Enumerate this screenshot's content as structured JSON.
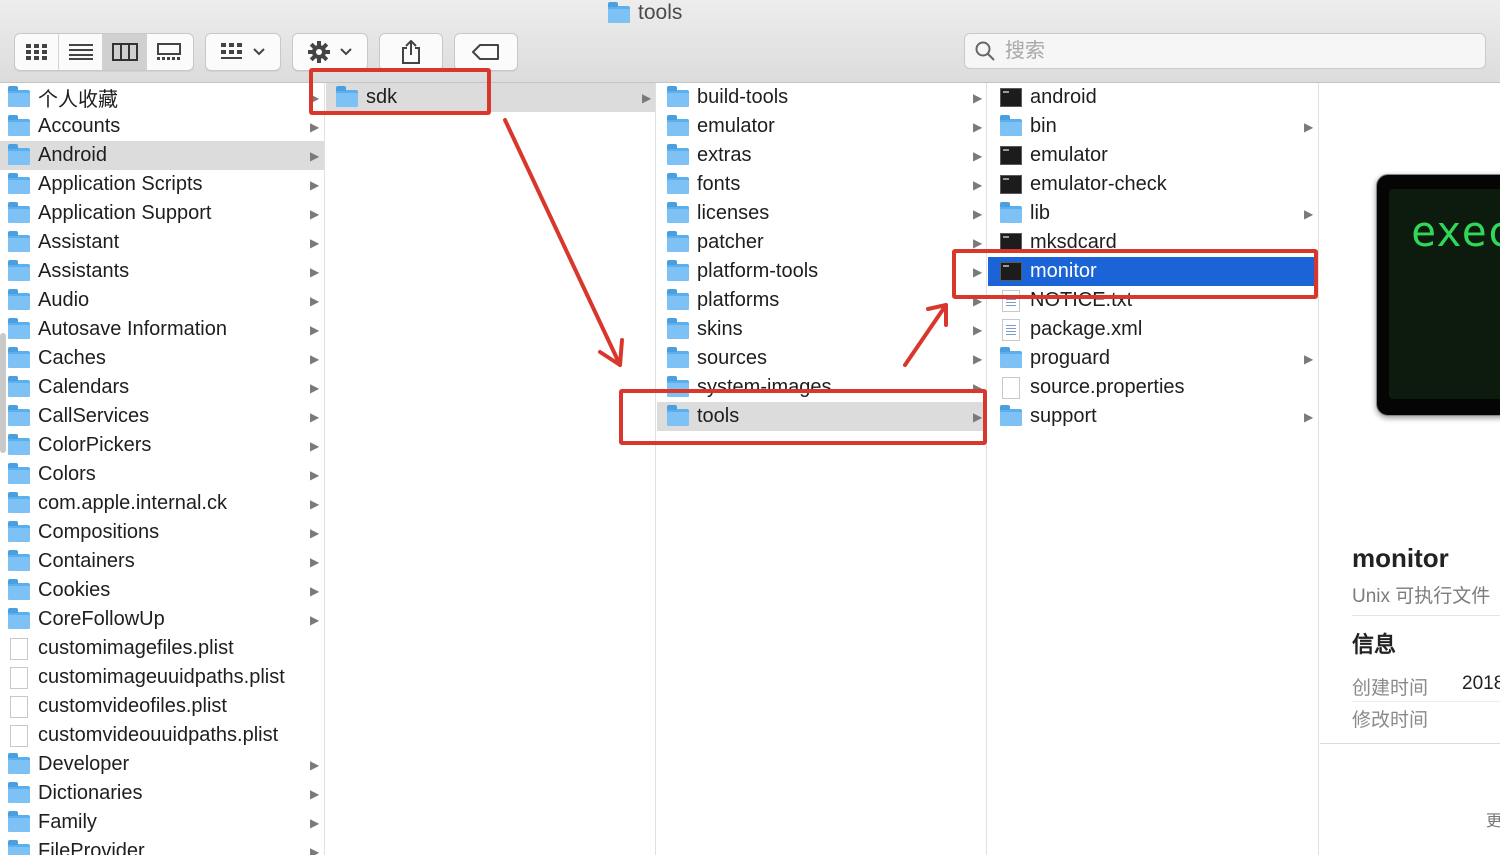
{
  "window": {
    "title": "tools"
  },
  "toolbar": {
    "view_icons": [
      "icon-view-icon",
      "list-view-icon",
      "column-view-icon",
      "gallery-view-icon"
    ],
    "group_icon": "group-by-icon",
    "action_icon": "gear-icon",
    "share_icon": "share-icon",
    "tag_icon": "tag-icon"
  },
  "search": {
    "placeholder": "搜索"
  },
  "column1": {
    "items": [
      {
        "name": "个人收藏",
        "type": "folder",
        "arrow": true
      },
      {
        "name": "Accounts",
        "type": "folder",
        "arrow": true
      },
      {
        "name": "Android",
        "type": "folder",
        "arrow": true,
        "selected": true
      },
      {
        "name": "Application Scripts",
        "type": "folder",
        "arrow": true
      },
      {
        "name": "Application Support",
        "type": "folder",
        "arrow": true
      },
      {
        "name": "Assistant",
        "type": "folder",
        "arrow": true
      },
      {
        "name": "Assistants",
        "type": "folder",
        "arrow": true
      },
      {
        "name": "Audio",
        "type": "folder",
        "arrow": true
      },
      {
        "name": "Autosave Information",
        "type": "folder",
        "arrow": true
      },
      {
        "name": "Caches",
        "type": "folder",
        "arrow": true
      },
      {
        "name": "Calendars",
        "type": "folder",
        "arrow": true
      },
      {
        "name": "CallServices",
        "type": "folder",
        "arrow": true
      },
      {
        "name": "ColorPickers",
        "type": "folder",
        "arrow": true
      },
      {
        "name": "Colors",
        "type": "folder",
        "arrow": true
      },
      {
        "name": "com.apple.internal.ck",
        "type": "folder",
        "arrow": true
      },
      {
        "name": "Compositions",
        "type": "folder",
        "arrow": true
      },
      {
        "name": "Containers",
        "type": "folder",
        "arrow": true
      },
      {
        "name": "Cookies",
        "type": "folder",
        "arrow": true
      },
      {
        "name": "CoreFollowUp",
        "type": "folder",
        "arrow": true
      },
      {
        "name": "customimagefiles.plist",
        "type": "doc",
        "arrow": false
      },
      {
        "name": "customimageuuidpaths.plist",
        "type": "doc",
        "arrow": false
      },
      {
        "name": "customvideofiles.plist",
        "type": "doc",
        "arrow": false
      },
      {
        "name": "customvideouuidpaths.plist",
        "type": "doc",
        "arrow": false
      },
      {
        "name": "Developer",
        "type": "folder",
        "arrow": true
      },
      {
        "name": "Dictionaries",
        "type": "folder",
        "arrow": true
      },
      {
        "name": "Family",
        "type": "folder",
        "arrow": true
      },
      {
        "name": "FileProvider",
        "type": "folder",
        "arrow": true
      }
    ]
  },
  "column2": {
    "items": [
      {
        "name": "sdk",
        "type": "folder",
        "arrow": true,
        "selected": true
      }
    ]
  },
  "column3": {
    "items": [
      {
        "name": "build-tools",
        "type": "folder",
        "arrow": true
      },
      {
        "name": "emulator",
        "type": "folder",
        "arrow": true
      },
      {
        "name": "extras",
        "type": "folder",
        "arrow": true
      },
      {
        "name": "fonts",
        "type": "folder",
        "arrow": true
      },
      {
        "name": "licenses",
        "type": "folder",
        "arrow": true
      },
      {
        "name": "patcher",
        "type": "folder",
        "arrow": true
      },
      {
        "name": "platform-tools",
        "type": "folder",
        "arrow": true
      },
      {
        "name": "platforms",
        "type": "folder",
        "arrow": true
      },
      {
        "name": "skins",
        "type": "folder",
        "arrow": true
      },
      {
        "name": "sources",
        "type": "folder",
        "arrow": true
      },
      {
        "name": "system-images",
        "type": "folder",
        "arrow": true
      },
      {
        "name": "tools",
        "type": "folder",
        "arrow": true,
        "selected": true
      }
    ]
  },
  "column4": {
    "items": [
      {
        "name": "android",
        "type": "exec",
        "arrow": false
      },
      {
        "name": "bin",
        "type": "folder",
        "arrow": true
      },
      {
        "name": "emulator",
        "type": "exec",
        "arrow": false
      },
      {
        "name": "emulator-check",
        "type": "exec",
        "arrow": false
      },
      {
        "name": "lib",
        "type": "folder",
        "arrow": true
      },
      {
        "name": "mksdcard",
        "type": "exec",
        "arrow": false
      },
      {
        "name": "monitor",
        "type": "exec",
        "arrow": false,
        "highlighted": true
      },
      {
        "name": "NOTICE.txt",
        "type": "txt",
        "arrow": false
      },
      {
        "name": "package.xml",
        "type": "txt",
        "arrow": false
      },
      {
        "name": "proguard",
        "type": "folder",
        "arrow": true
      },
      {
        "name": "source.properties",
        "type": "doc",
        "arrow": false
      },
      {
        "name": "support",
        "type": "folder",
        "arrow": true
      }
    ]
  },
  "preview": {
    "thumbnail_text": "exec",
    "name": "monitor",
    "kind": "Unix 可执行文件",
    "info_heading": "信息",
    "created_label": "创建时间",
    "created_value": "2018",
    "modified_label": "修改时间",
    "more_label": "更"
  },
  "colors": {
    "annotation_red": "#d9372c",
    "selection_blue": "#1b64d8",
    "selection_gray": "#dcdcdc",
    "folder_blue": "#5ab0ef"
  }
}
